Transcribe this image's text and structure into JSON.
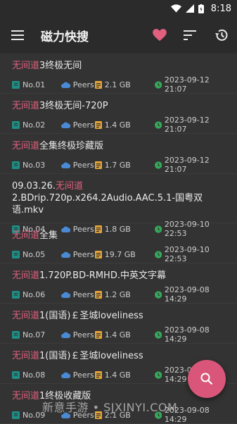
{
  "status_bar": {
    "time": "8:18",
    "icons": [
      "wifi-icon",
      "signal-icon",
      "battery-icon"
    ]
  },
  "app_bar": {
    "title": "磁力快搜",
    "icons": [
      "menu-icon",
      "heart-icon",
      "sort-icon",
      "history-icon"
    ],
    "accent": "#e0607e"
  },
  "items": [
    {
      "hl": "无间道",
      "rest": "3终极无间",
      "no": "No.01",
      "peers": "Peers",
      "size": "2.1 GB",
      "date": "2023-09-12 21:07"
    },
    {
      "hl": "无间道",
      "rest": "3终极无间-720P",
      "no": "No.02",
      "peers": "Peers",
      "size": "1.4 GB",
      "date": "2023-09-12 21:07"
    },
    {
      "hl": "无间道",
      "rest": "全集终极珍藏版",
      "no": "No.03",
      "peers": "Peers",
      "size": "1.7 GB",
      "date": "2023-09-12 21:07"
    },
    {
      "pre": "09.03.26.",
      "hl": "无间道",
      "rest": "2.BDrip.720p.x264.2Audio.AAC.5.1-国粤双语.mkv",
      "no": "No.04",
      "peers": "Peers",
      "size": "1.8 GB",
      "date": "2023-09-10 22:53"
    },
    {
      "hl": "无间道",
      "rest": "全集",
      "no": "No.05",
      "peers": "Peers",
      "size": "19.7 GB",
      "date": "2023-09-10 22:53"
    },
    {
      "hl": "无间道",
      "rest": "1.720P.BD-RMHD.中英文字幕",
      "no": "No.06",
      "peers": "Peers",
      "size": "1.2 GB",
      "date": "2023-09-08 14:29"
    },
    {
      "hl": "无间道",
      "rest": "1(国语)￡圣城loveliness",
      "no": "No.07",
      "peers": "Peers",
      "size": "1.4 GB",
      "date": "2023-09-08 14:29"
    },
    {
      "hl": "无间道",
      "rest": "1(国语)￡圣城loveliness",
      "no": "No.08",
      "peers": "Peers",
      "size": "1.4 GB",
      "date": "2023-09-08 14:29"
    },
    {
      "hl": "无间道",
      "rest": "1终极收藏版",
      "no": "No.09",
      "peers": "Peers",
      "size": "2.1 GB",
      "date": "2023-09-08 14:29"
    }
  ],
  "fab": {
    "icon": "search-icon"
  },
  "watermark": "新意手游 • SJXINYI.COM"
}
